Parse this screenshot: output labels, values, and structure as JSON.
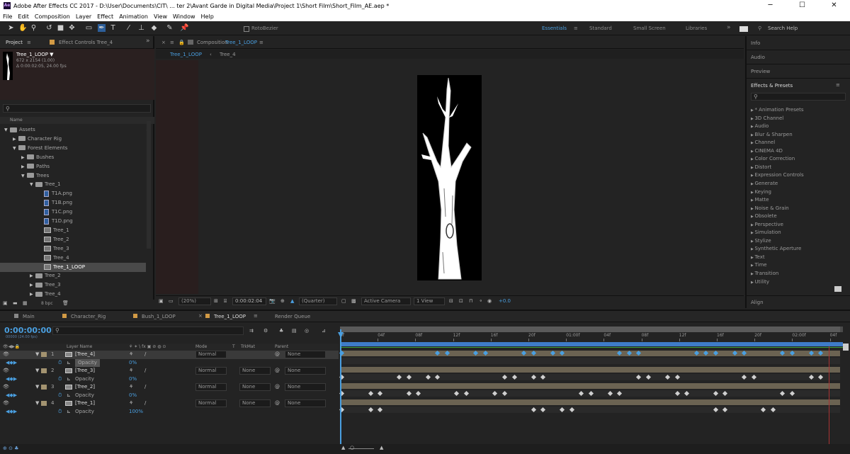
{
  "titlebar": {
    "title": "Adobe After Effects CC 2017 - D:\\User\\Documents\\CIT\\ ... ter 2\\Avant Garde in Digital Media\\Project 1\\Short Film\\Short_Film_AE.aep *",
    "app_icon": "Ae",
    "minimize": "─",
    "maximize": "☐",
    "close": "✕"
  },
  "menu": [
    "File",
    "Edit",
    "Composition",
    "Layer",
    "Effect",
    "Animation",
    "View",
    "Window",
    "Help"
  ],
  "toolbar": {
    "rotobezier": "RotoBezier",
    "workspaces": [
      "Essentials",
      "Standard",
      "Small Screen",
      "Libraries"
    ],
    "more": "»",
    "search_help": "Search Help"
  },
  "project": {
    "tab_project": "Project",
    "tab_effect_controls": "Effect Controls Tree_4",
    "comp_name": "Tree_1_LOOP ▼",
    "comp_dims": "672 x 2154 (1.00)",
    "comp_duration": "Δ 0:00:02:05, 24.00 fps",
    "search_placeholder": "",
    "col_name": "Name",
    "bpc": "8 bpc",
    "tree": [
      {
        "label": "Assets",
        "type": "folder",
        "open": true,
        "indent": 0
      },
      {
        "label": "Character Rig",
        "type": "folder",
        "open": false,
        "indent": 1
      },
      {
        "label": "Forest Elements",
        "type": "folder",
        "open": true,
        "indent": 1
      },
      {
        "label": "Bushes",
        "type": "folder",
        "open": false,
        "indent": 2
      },
      {
        "label": "Paths",
        "type": "folder",
        "open": false,
        "indent": 2
      },
      {
        "label": "Trees",
        "type": "folder",
        "open": true,
        "indent": 2
      },
      {
        "label": "Tree_1",
        "type": "folder",
        "open": true,
        "indent": 3
      },
      {
        "label": "T1A.png",
        "type": "png",
        "indent": 4
      },
      {
        "label": "T1B.png",
        "type": "png",
        "indent": 4
      },
      {
        "label": "T1C.png",
        "type": "png",
        "indent": 4
      },
      {
        "label": "T1D.png",
        "type": "png",
        "indent": 4
      },
      {
        "label": "Tree_1",
        "type": "comp",
        "indent": 4
      },
      {
        "label": "Tree_2",
        "type": "comp",
        "indent": 4
      },
      {
        "label": "Tree_3",
        "type": "comp",
        "indent": 4
      },
      {
        "label": "Tree_4",
        "type": "comp",
        "indent": 4
      },
      {
        "label": "Tree_1_LOOP",
        "type": "comp",
        "indent": 4,
        "selected": true
      },
      {
        "label": "Tree_2",
        "type": "folder",
        "open": false,
        "indent": 3
      },
      {
        "label": "Tree_3",
        "type": "folder",
        "open": false,
        "indent": 3
      },
      {
        "label": "Tree_4",
        "type": "folder",
        "open": false,
        "indent": 3
      }
    ]
  },
  "viewer": {
    "tab_label": "Composition",
    "tab_comp": "Tree_1_LOOP",
    "breadcrumbs": [
      "Tree_1_LOOP",
      "Tree_4"
    ],
    "zoom": "(20%)",
    "timecode": "0:00:02:04",
    "resolution": "(Quarter)",
    "camera": "Active Camera",
    "views": "1 View",
    "exposure": "+0.0"
  },
  "effects_panel": {
    "info": "Info",
    "audio": "Audio",
    "preview": "Preview",
    "title": "Effects & Presets",
    "items": [
      "* Animation Presets",
      "3D Channel",
      "Audio",
      "Blur & Sharpen",
      "Channel",
      "CINEMA 4D",
      "Color Correction",
      "Distort",
      "Expression Controls",
      "Generate",
      "Keying",
      "Matte",
      "Noise & Grain",
      "Obsolete",
      "Perspective",
      "Simulation",
      "Stylize",
      "Synthetic Aperture",
      "Text",
      "Time",
      "Transition",
      "Utility"
    ],
    "align": "Align"
  },
  "timeline": {
    "tabs": [
      "Main",
      "Character_Rig",
      "Bush_1_LOOP",
      "Tree_1_LOOP",
      "Render Queue"
    ],
    "timecode": "0:00:00:00",
    "timecode_sub": "00000 (24.00 fps)",
    "col_layer_name": "Layer Name",
    "col_mode": "Mode",
    "col_t": "T",
    "col_trkmat": "TrkMat",
    "col_parent": "Parent",
    "ruler": [
      "0f",
      "04f",
      "08f",
      "12f",
      "16f",
      "20f",
      "01:00f",
      "04f",
      "08f",
      "12f",
      "16f",
      "20f",
      "02:00f",
      "04f"
    ],
    "layers": [
      {
        "num": "1",
        "name": "[Tree_4]",
        "mode": "Normal",
        "trkmat": "",
        "parent": "None",
        "opacity": "0%"
      },
      {
        "num": "2",
        "name": "[Tree_3]",
        "mode": "Normal",
        "trkmat": "None",
        "parent": "None",
        "opacity": "0%"
      },
      {
        "num": "3",
        "name": "[Tree_2]",
        "mode": "Normal",
        "trkmat": "None",
        "parent": "None",
        "opacity": "0%"
      },
      {
        "num": "4",
        "name": "[Tree_1]",
        "mode": "Normal",
        "trkmat": "None",
        "parent": "None",
        "opacity": "100%"
      }
    ],
    "opacity_label": "Opacity",
    "keyframes": [
      [
        0,
        10,
        11,
        14,
        15,
        19,
        20,
        22,
        23,
        29,
        30,
        31,
        37,
        38,
        39,
        41,
        42,
        46,
        47,
        49,
        50
      ],
      [
        0,
        6,
        7,
        9,
        10,
        17,
        18,
        20,
        21,
        31,
        32,
        34,
        35,
        42,
        43,
        49,
        50
      ],
      [
        0,
        3,
        4,
        7,
        8,
        12,
        13,
        16,
        17,
        25,
        26,
        28,
        29,
        35,
        36,
        39,
        40,
        46,
        47
      ],
      [
        0,
        3,
        4,
        20,
        21,
        23,
        24,
        39,
        40,
        44,
        45
      ]
    ]
  },
  "colors": {
    "accent": "#4a9fe0",
    "track": "#6b6352",
    "work_area": "#3f7cc8"
  }
}
